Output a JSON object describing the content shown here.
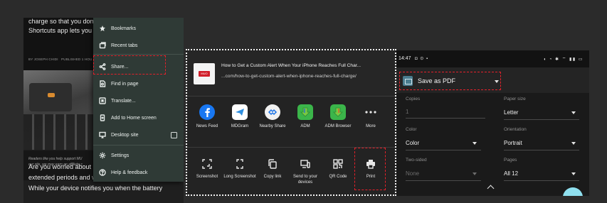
{
  "article": {
    "line1": "charge so that you don't le",
    "line2": "Shortcuts app lets you se",
    "byline_author": "BY JOSEPH CHIDI",
    "byline_published": "PUBLISHED 1 HOU",
    "notice1": "Readers like you help support MU",
    "notice2": "our site, we may earn an affiliate c",
    "body1": "Are you worried about le",
    "body2": "extended periods and w",
    "body3": "While your device notifies you when the battery"
  },
  "menu": {
    "items": [
      {
        "label": "Bookmarks",
        "icon": "star-icon"
      },
      {
        "label": "Recent tabs",
        "icon": "recent-tabs-icon"
      },
      {
        "label": "Share...",
        "icon": "share-icon"
      },
      {
        "label": "Find in page",
        "icon": "find-in-page-icon"
      },
      {
        "label": "Translate...",
        "icon": "translate-icon"
      },
      {
        "label": "Add to Home screen",
        "icon": "add-to-home-icon"
      },
      {
        "label": "Desktop site",
        "icon": "desktop-icon"
      },
      {
        "label": "Settings",
        "icon": "gear-icon"
      },
      {
        "label": "Help & feedback",
        "icon": "help-icon"
      }
    ]
  },
  "share": {
    "thumb_logo": "MUO",
    "title": "How to Get a Custom Alert When Your iPhone Reaches Full Char...",
    "url": "...com/how-to-get-custom-alert-when-iphone-reaches-full-charge/",
    "apps": [
      {
        "label": "News Feed",
        "icon": "facebook-icon",
        "color": "#1877f2"
      },
      {
        "label": "MDGram",
        "icon": "mdgram-icon",
        "color": "#ffffff"
      },
      {
        "label": "Nearby Share",
        "icon": "nearby-share-icon",
        "color": "#f1f1f1"
      },
      {
        "label": "ADM",
        "icon": "adm-icon",
        "color": "#3bb54a"
      },
      {
        "label": "ADM Browser",
        "icon": "adm-browser-icon",
        "color": "#3bb54a"
      },
      {
        "label": "More",
        "icon": "more-dots-icon",
        "color": "#232323"
      }
    ],
    "actions": [
      {
        "label": "Screenshot",
        "icon": "screenshot-icon"
      },
      {
        "label": "Long Screenshot",
        "icon": "long-screenshot-icon"
      },
      {
        "label": "Copy link",
        "icon": "copy-link-icon"
      },
      {
        "label": "Send to your devices",
        "icon": "send-to-devices-icon"
      },
      {
        "label": "QR Code",
        "icon": "qr-code-icon"
      },
      {
        "label": "Print",
        "icon": "print-icon"
      }
    ]
  },
  "print": {
    "status_time": "14:47",
    "printer": "Save as PDF",
    "copies_label": "Copies",
    "copies_value": "1",
    "paper_label": "Paper size",
    "paper_value": "Letter",
    "color_label": "Color",
    "color_value": "Color",
    "orientation_label": "Orientation",
    "orientation_value": "Portrait",
    "twosided_label": "Two-sided",
    "twosided_value": "None",
    "pages_label": "Pages",
    "pages_value": "All 12"
  },
  "colors": {
    "highlight": "#e5202a",
    "menu_bg": "#2f3a36"
  }
}
